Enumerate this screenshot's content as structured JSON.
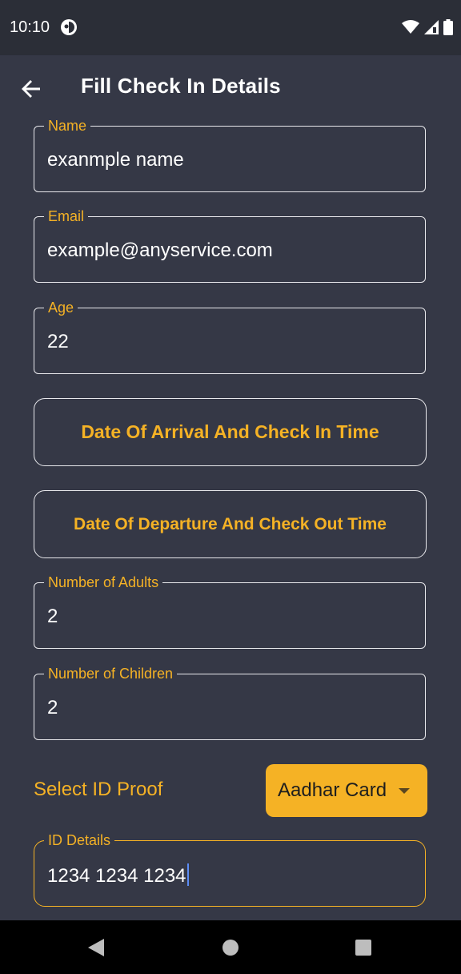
{
  "status_bar": {
    "time": "10:10"
  },
  "app_bar": {
    "title": "Fill Check In Details"
  },
  "form": {
    "name": {
      "label": "Name",
      "value": "exanmple name"
    },
    "email": {
      "label": "Email",
      "value": "example@anyservice.com"
    },
    "age": {
      "label": "Age",
      "value": "22"
    },
    "arrival_button": "Date Of Arrival And Check In Time",
    "departure_button": "Date Of Departure And Check Out Time",
    "adults": {
      "label": "Number of Adults",
      "value": "2"
    },
    "children": {
      "label": "Number of Children",
      "value": "2"
    },
    "id_proof": {
      "label": "Select ID Proof",
      "selected": "Aadhar Card"
    },
    "id_details": {
      "label": "ID Details",
      "value": "1234 1234 1234"
    }
  },
  "colors": {
    "background": "#353846",
    "status_bar": "#2b2e37",
    "accent": "#f5b225",
    "text": "#ffffff",
    "nav_bar": "#000000"
  },
  "icons": {
    "back": "arrow-left-icon",
    "wifi": "wifi-icon",
    "signal": "signal-icon",
    "battery": "battery-icon",
    "nav_back": "triangle-back-icon",
    "nav_home": "circle-home-icon",
    "nav_recents": "square-recents-icon"
  }
}
